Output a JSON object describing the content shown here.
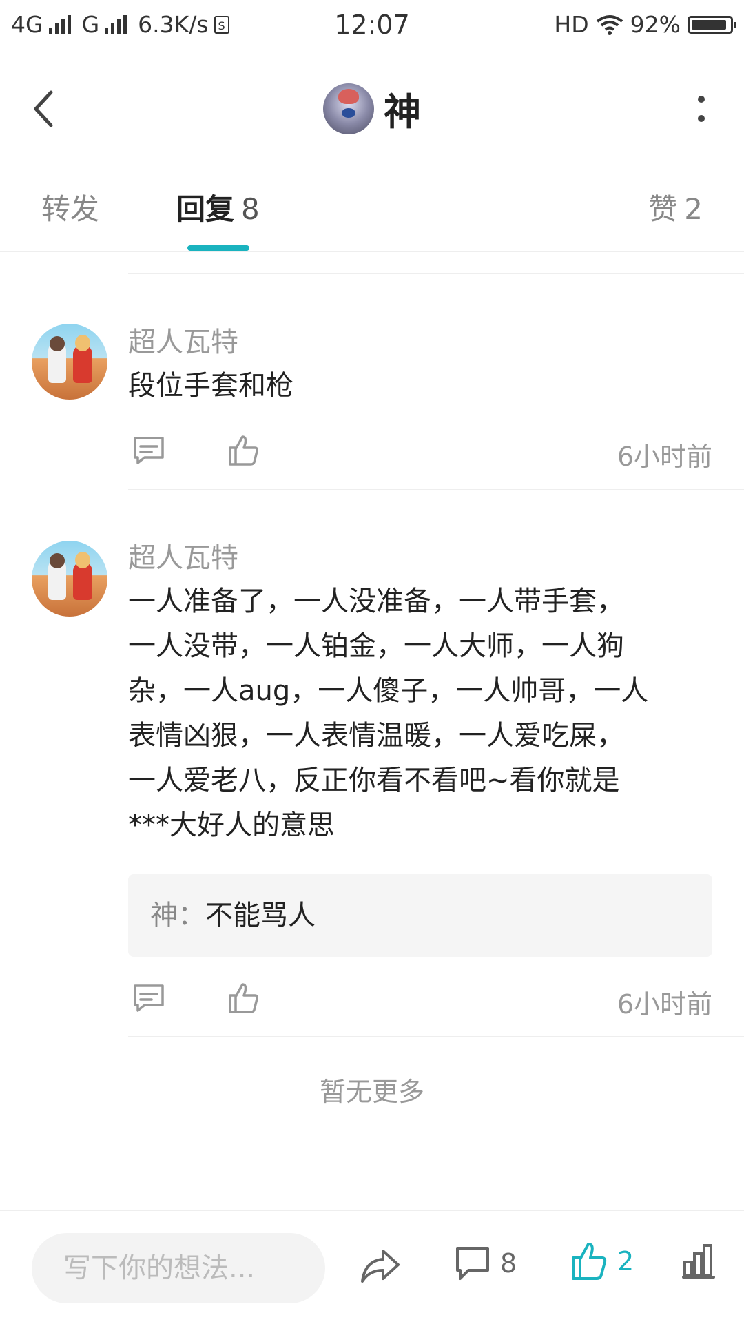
{
  "status_bar": {
    "network1": "4G",
    "network2": "G",
    "speed": "6.3K/s",
    "time": "12:07",
    "hd": "HD",
    "battery": "92%",
    "battery_level": 0.92
  },
  "header": {
    "title": "神",
    "icons": {
      "back": "back-arrow-icon",
      "more": "more-vertical-icon"
    }
  },
  "tabs": [
    {
      "label": "转发",
      "count": ""
    },
    {
      "label": "回复",
      "count": "8"
    },
    {
      "label": "赞",
      "count": "2"
    }
  ],
  "comments": [
    {
      "author": "超人瓦特",
      "text": "段位手套和枪",
      "time": "6小时前"
    },
    {
      "author": "超人瓦特",
      "text": "一人准备了，一人没准备，一人带手套，\n一人没带，一人铂金，一人大师，一人狗\n杂，一人aug，一人傻子，一人帅哥，一人\n表情凶狠，一人表情温暖，一人爱吃屎，\n一人爱老八，反正你看不看吧~看你就是\n***大好人的意思",
      "reply": {
        "name": "神：",
        "text": "不能骂人"
      },
      "time": "6小时前"
    }
  ],
  "no_more": "暂无更多",
  "bottom_bar": {
    "input_placeholder": "写下你的想法...",
    "comment_count": "8",
    "like_count": "2",
    "accent_color": "#1ab3bf"
  }
}
